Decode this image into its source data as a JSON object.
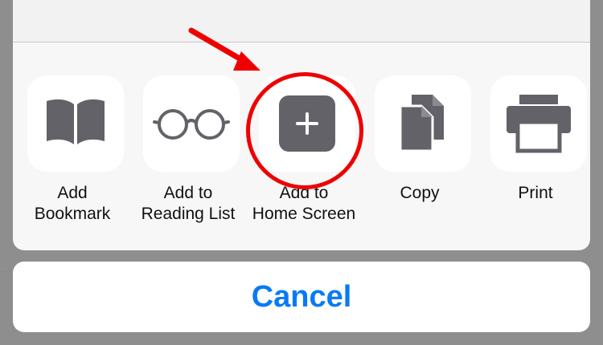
{
  "share_sheet": {
    "actions": [
      {
        "label": "Add\nBookmark",
        "icon": "book-icon"
      },
      {
        "label": "Add to\nReading List",
        "icon": "glasses-icon"
      },
      {
        "label": "Add to\nHome Screen",
        "icon": "plus-square-icon"
      },
      {
        "label": "Copy",
        "icon": "copy-documents-icon"
      },
      {
        "label": "Print",
        "icon": "printer-icon"
      }
    ],
    "cancel_label": "Cancel"
  },
  "colors": {
    "sheet_background": "#f7f7f7",
    "tile_background": "#ffffff",
    "icon_gray": "#626268",
    "cancel_blue": "#0a7af4",
    "annotation_red": "#ee0000",
    "backdrop": "#8e8e8e"
  },
  "annotation": {
    "highlighted_action": "Add to\nHome Screen",
    "type": "red circle and arrow"
  }
}
